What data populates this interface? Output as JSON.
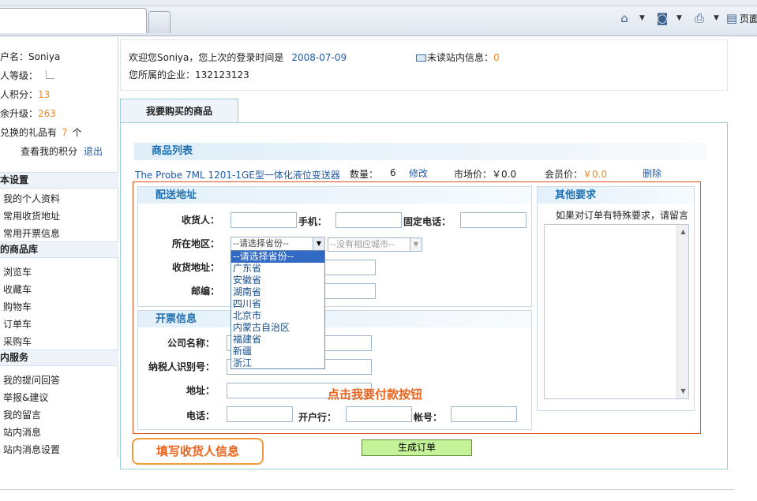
{
  "browser": {
    "page_label": "页面"
  },
  "sidebar": {
    "username_label": "户名：",
    "username": "Soniya",
    "level_label": "人等级：",
    "points_label": "人积分：",
    "points": "13",
    "upgrade_label": "余升级：",
    "upgrade": "263",
    "gifts_prefix": "兑换的礼品有",
    "gifts_count": "7",
    "gifts_suffix": "个",
    "view_points": "查看我的积分",
    "logout": "退出",
    "sections": [
      {
        "title": "本设置",
        "items": [
          "我的个人资料",
          "常用收货地址",
          "常用开票信息"
        ]
      },
      {
        "title": "的商品库",
        "items": [
          "浏览车",
          "收藏车",
          "购物车",
          "订单车",
          "采购车"
        ]
      },
      {
        "title": "内服务",
        "items": [
          "我的提问回答",
          "举报&建议",
          "我的留言",
          "站内消息",
          "站内消息设置"
        ]
      }
    ]
  },
  "welcome": {
    "greeting": "欢迎您Soniya，您上次的登录时间是",
    "last_login": "2008-07-09",
    "company_label": "您所属的企业：",
    "company": "132123123",
    "unread_label": "未读站内信息：",
    "unread_count": "0"
  },
  "main": {
    "tab": "我要购买的商品",
    "list_header": "商品列表",
    "product": {
      "name": "The Probe 7ML 1201-1GE型一体化液位变送器",
      "qty_label": "数量：",
      "qty": "6",
      "edit": "修改",
      "market_label": "市场价：",
      "market_price": "￥0.0",
      "member_label": "会员价：",
      "member_price": "￥0.0",
      "delete": "删除"
    }
  },
  "shipping": {
    "title": "配送地址",
    "receiver": "收货人：",
    "mobile": "手机：",
    "phone": "固定电话：",
    "region": "所在地区：",
    "province_selected": "--请选择省份--",
    "city_selected": "--没有相应城市--",
    "address": "收货地址：",
    "zip": "邮编：",
    "province_options": [
      "--请选择省份--",
      "广东省",
      "安徽省",
      "湖南省",
      "四川省",
      "北京市",
      "内蒙古自治区",
      "福建省",
      "新疆",
      "浙江"
    ]
  },
  "invoice": {
    "title": "开票信息",
    "company": "公司名称：",
    "tax_id": "纳税人识别号：",
    "address": "地址：",
    "phone": "电话：",
    "bank": "开户行：",
    "account": "帐号："
  },
  "other": {
    "title": "其他要求",
    "hint": "如果对订单有特殊要求，请留言"
  },
  "annotations": {
    "pay": "点击我要付款按钮",
    "fill": "填写收货人信息"
  },
  "actions": {
    "generate": "生成订单"
  }
}
